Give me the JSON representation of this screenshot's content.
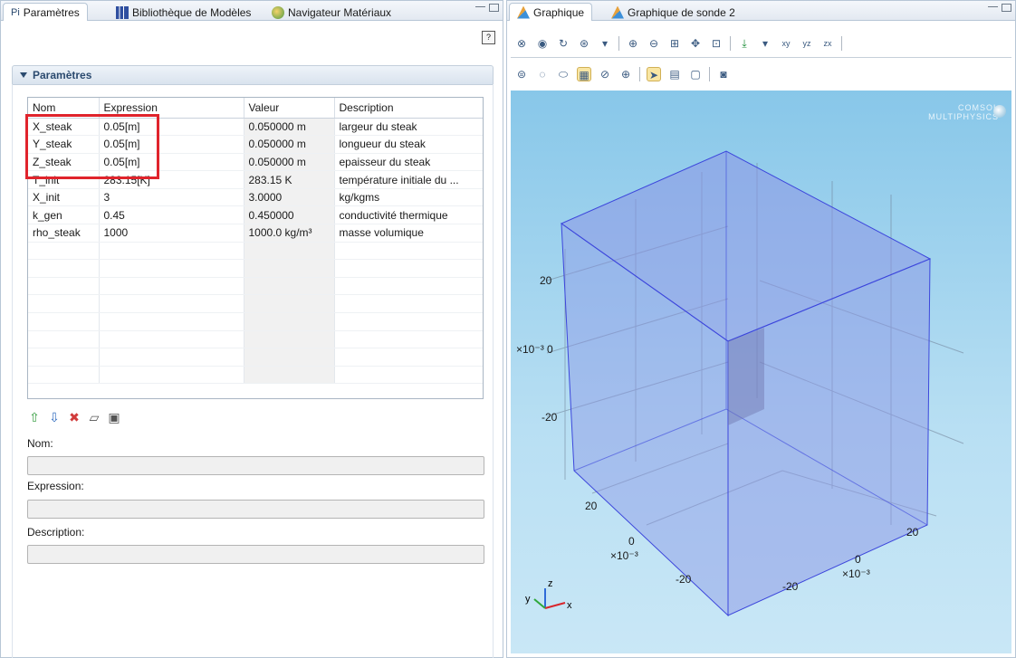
{
  "left_tabs": [
    {
      "label": "Paramètres",
      "prefix": "Pi"
    },
    {
      "label": "Bibliothèque de Modèles"
    },
    {
      "label": "Navigateur Matériaux"
    }
  ],
  "right_tabs": [
    {
      "label": "Graphique"
    },
    {
      "label": "Graphique de sonde 2"
    }
  ],
  "section_title": "Paramètres",
  "table": {
    "headers": [
      "Nom",
      "Expression",
      "Valeur",
      "Description"
    ],
    "rows": [
      [
        "X_steak",
        "0.05[m]",
        "0.050000 m",
        "largeur du steak"
      ],
      [
        "Y_steak",
        "0.05[m]",
        "0.050000 m",
        "longueur du steak"
      ],
      [
        "Z_steak",
        "0.05[m]",
        "0.050000 m",
        "epaisseur du steak"
      ],
      [
        "T_init",
        "283.15[K]",
        "283.15 K",
        "température initiale du ..."
      ],
      [
        "X_init",
        "3",
        "3.0000",
        "kg/kgms"
      ],
      [
        "k_gen",
        "0.45",
        "0.450000",
        "conductivité thermique"
      ],
      [
        "rho_steak",
        "1000",
        "1000.0 kg/m³",
        "masse volumique"
      ]
    ]
  },
  "form": {
    "name_label": "Nom:",
    "expression_label": "Expression:",
    "description_label": "Description:"
  },
  "viewport": {
    "logo_line1": "COMSOL",
    "logo_line2": "MULTIPHYSICS",
    "z_ticks": [
      "20",
      "0",
      "-20"
    ],
    "z_scale": "×10⁻³",
    "y_ticks": [
      "20",
      "0",
      "-20"
    ],
    "y_scale": "×10⁻³",
    "x_ticks": [
      "20",
      "0",
      "-20"
    ],
    "x_scale": "×10⁻³",
    "triad": {
      "x": "x",
      "y": "y",
      "z": "z"
    }
  },
  "colors": {
    "highlight": "#e0242c",
    "cube_fill": "#8c96e6",
    "cube_edge": "#3c46dc"
  }
}
